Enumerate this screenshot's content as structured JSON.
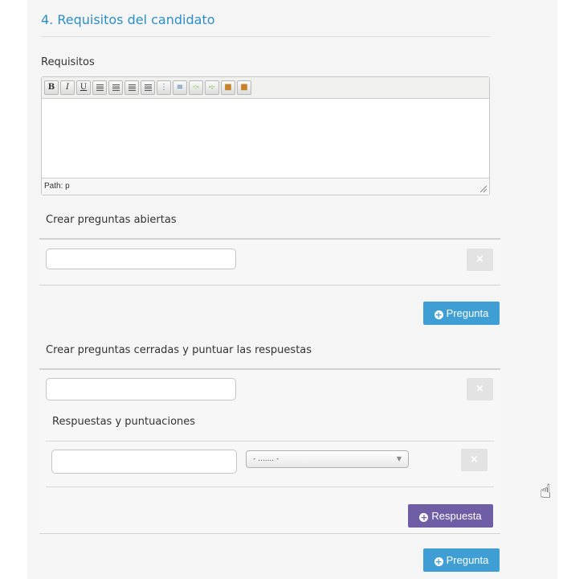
{
  "section": {
    "title": "4. Requisitos del candidato"
  },
  "requisitos": {
    "label": "Requisitos",
    "toolbar": [
      "B",
      "I",
      "U",
      "align-left",
      "align-center",
      "align-right",
      "align-justify",
      "bullet-list",
      "numbered-list",
      "undo",
      "redo",
      "paste",
      "paste-word"
    ],
    "path_text": "Path: p"
  },
  "open_questions": {
    "label": "Crear preguntas abiertas",
    "input_value": "",
    "remove_label": "×",
    "add_label": "Pregunta"
  },
  "closed_questions": {
    "label": "Crear preguntas cerradas y puntuar las respuestas",
    "input_value": "",
    "remove_label": "×",
    "answers_label": "Respuestas y puntuaciones",
    "answer_input_value": "",
    "score_select_value": "- ....... -",
    "answer_remove_label": "×",
    "add_answer_label": "Respuesta",
    "add_question_label": "Pregunta"
  },
  "icons": {
    "add": "plus-circle-icon",
    "remove": "close-icon",
    "cursor": "hand-pointer-icon"
  },
  "colors": {
    "title": "#2b8fc6",
    "primary_button": "#3f9fd5",
    "answer_button": "#6f5ea6"
  }
}
